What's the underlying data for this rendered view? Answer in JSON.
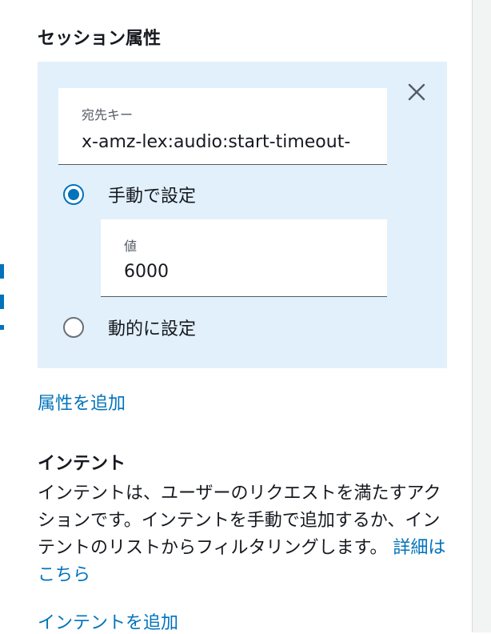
{
  "session_attributes": {
    "title": "セッション属性",
    "key_field": {
      "label": "宛先キー",
      "value": "x-amz-lex:audio:start-timeout-"
    },
    "manual_option": {
      "label": "手動で設定",
      "selected": true
    },
    "value_field": {
      "label": "値",
      "value": "6000"
    },
    "dynamic_option": {
      "label": "動的に設定",
      "selected": false
    },
    "close_icon": "close-icon",
    "add_link": "属性を追加"
  },
  "intents": {
    "title": "インテント",
    "description": "インテントは、ユーザーのリクエストを満たすアクションです。インテントを手動で追加するか、インテントのリストからフィルタリングします。",
    "learn_more": "詳細はこちら",
    "add_link": "インテントを追加"
  },
  "colors": {
    "accent": "#0073bb",
    "panel_bg": "#e1f0fb",
    "text": "#16191f"
  }
}
